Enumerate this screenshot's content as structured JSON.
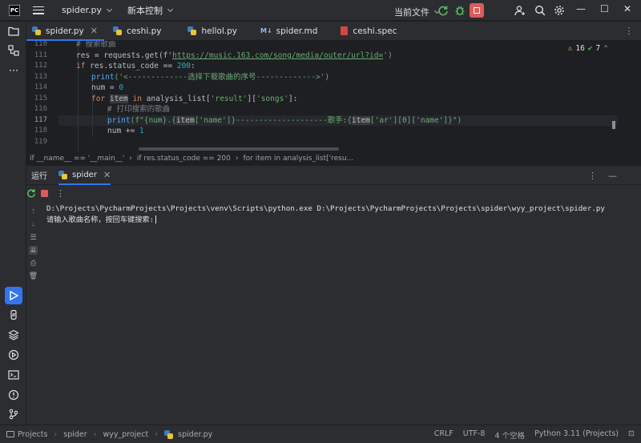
{
  "titlebar": {
    "project": "spider.py",
    "vcs": "新本控制",
    "run_config": "当前文件"
  },
  "tabs": [
    {
      "label": "spider.py",
      "icon": "python-file-icon",
      "active": true
    },
    {
      "label": "ceshi.py",
      "icon": "python-file-icon",
      "active": false
    },
    {
      "label": "hellol.py",
      "icon": "python-file-icon",
      "active": false
    },
    {
      "label": "spider.md",
      "icon": "markdown-file-icon",
      "active": false
    },
    {
      "label": "ceshi.spec",
      "icon": "spec-file-icon",
      "active": false
    }
  ],
  "editor": {
    "warnings_count": "16",
    "checks_count": "7",
    "line_numbers": [
      "110",
      "111",
      "112",
      "113",
      "114",
      "115",
      "116",
      "117",
      "118",
      "119"
    ],
    "current_line": "117",
    "lines": {
      "l110": "# 搜索歌曲",
      "l111_a": "res = requests.get(f'",
      "l111_url": "https://music.163.com/song/media/outer/url?id=",
      "l111_b": "')",
      "l112_a": "if ",
      "l112_b": "res.status_code == ",
      "l112_num": "200",
      "l112_c": ":",
      "l113_fn": "print",
      "l113_str": "('<-------------选择下载歌曲的序号------------->')",
      "l114_a": "num = ",
      "l114_num": "0",
      "l115_for": "for ",
      "l115_item": "item",
      "l115_in": " in ",
      "l115_rest": "analysis_list[",
      "l115_s1": "'result'",
      "l115_mid": "][",
      "l115_s2": "'songs'",
      "l115_end": "]:",
      "l116": "# 打印搜索的歌曲",
      "l117_fn": "print",
      "l117_a": "(f\"{num}.{",
      "l117_item1": "item",
      "l117_b": "['name']}",
      "l117_dash": "--------------------歌手:{",
      "l117_item2": "item",
      "l117_c": "['ar'][0]['name']}",
      "l117_d": "\")",
      "l118_a": "num += ",
      "l118_num": "1"
    }
  },
  "breadcrumbs": [
    "if __name__ == '__main__'",
    "if res.status_code == 200",
    "for item in analysis_list['resu..."
  ],
  "run": {
    "title": "运行",
    "tab_label": "spider",
    "console": [
      "D:\\Projects\\PycharmProjects\\Projects\\venv\\Scripts\\python.exe D:\\Projects\\PycharmProjects\\Projects\\spider\\wyy_project\\spider.py",
      "请输入歌曲名称，按回车键搜索:"
    ]
  },
  "statusbar": {
    "path": [
      "Projects",
      "spider",
      "wyy_project",
      "spider.py"
    ],
    "line_sep": "CRLF",
    "encoding": "UTF-8",
    "indent": "4 个空格",
    "interpreter": "Python 3.11 (Projects)"
  },
  "colors": {
    "accent": "#3574f0",
    "stop": "#db5c5c",
    "run_green": "#5fb865"
  }
}
